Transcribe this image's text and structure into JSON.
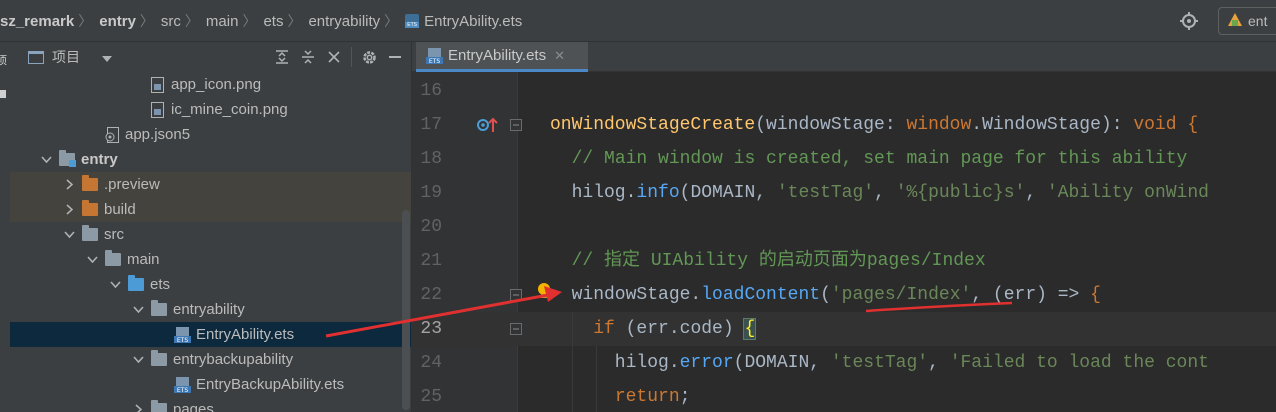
{
  "breadcrumb": {
    "items": [
      "sz_remark",
      "entry",
      "src",
      "main",
      "ets",
      "entryability",
      "EntryAbility.ets"
    ],
    "separator": "〉"
  },
  "toolbar": {
    "device_label": "ent"
  },
  "left_strip": {
    "label": "项"
  },
  "project_panel": {
    "title": "项目",
    "tree": [
      {
        "label": "app_icon.png",
        "indent": 5,
        "kind": "image-file"
      },
      {
        "label": "ic_mine_coin.png",
        "indent": 5,
        "kind": "image-file"
      },
      {
        "label": "app.json5",
        "indent": 3,
        "kind": "json-file"
      },
      {
        "label": "entry",
        "indent": 1,
        "kind": "module",
        "expanded": true
      },
      {
        "label": ".preview",
        "indent": 2,
        "kind": "folder-orange",
        "expanded": false
      },
      {
        "label": "build",
        "indent": 2,
        "kind": "folder-orange",
        "expanded": false
      },
      {
        "label": "src",
        "indent": 2,
        "kind": "folder-gray",
        "expanded": true
      },
      {
        "label": "main",
        "indent": 3,
        "kind": "folder-gray",
        "expanded": true
      },
      {
        "label": "ets",
        "indent": 4,
        "kind": "folder-blue",
        "expanded": true
      },
      {
        "label": "entryability",
        "indent": 5,
        "kind": "folder-gray",
        "expanded": true
      },
      {
        "label": "EntryAbility.ets",
        "indent": 6,
        "kind": "ets-file",
        "selected": true
      },
      {
        "label": "entrybackupability",
        "indent": 5,
        "kind": "folder-gray",
        "expanded": true
      },
      {
        "label": "EntryBackupAbility.ets",
        "indent": 6,
        "kind": "ets-file"
      },
      {
        "label": "pages",
        "indent": 5,
        "kind": "folder-gray",
        "expanded": false
      }
    ]
  },
  "editor": {
    "tab_label": "EntryAbility.ets",
    "lines": [
      {
        "num": "16",
        "html": ""
      },
      {
        "num": "17",
        "html": "<span class=\"fn\">onWindowStageCreate</span>(windowStage: <span class=\"kw\">window</span>.WindowStage): <span class=\"kw\">void</span> <span class=\"kw\">{</span>"
      },
      {
        "num": "18",
        "html": "  <span class=\"cmt\">// Main window is created, set main page for this ability</span>"
      },
      {
        "num": "19",
        "html": "  hilog.<span class=\"call\">info</span>(DOMAIN, <span class=\"str\">'testTag'</span>, <span class=\"str\">'%{public}s'</span>, <span class=\"str\">'Ability onWind</span>"
      },
      {
        "num": "20",
        "html": ""
      },
      {
        "num": "21",
        "html": "  <span class=\"cmt\">// 指定 UIAbility 的启动页面为pages/Index</span>"
      },
      {
        "num": "22",
        "html": "  windowStage.<span class=\"call\">loadContent</span>(<span class=\"str\">'pages/Index'</span>, (err) => <span class=\"kw\">{</span>"
      },
      {
        "num": "23",
        "html": "    <span class=\"kw\">if</span> (err.code) <span class=\"brace-hl\">{</span>"
      },
      {
        "num": "24",
        "html": "      hilog.<span class=\"call\">error</span>(DOMAIN, <span class=\"str\">'testTag'</span>, <span class=\"str\">'Failed to load the cont</span>"
      },
      {
        "num": "25",
        "html": "      <span class=\"kw\">return</span>;"
      }
    ],
    "current_line": "23"
  },
  "colors": {
    "accent": "#4a88c7",
    "annotation": "#e03030",
    "selection": "#0d293e"
  }
}
